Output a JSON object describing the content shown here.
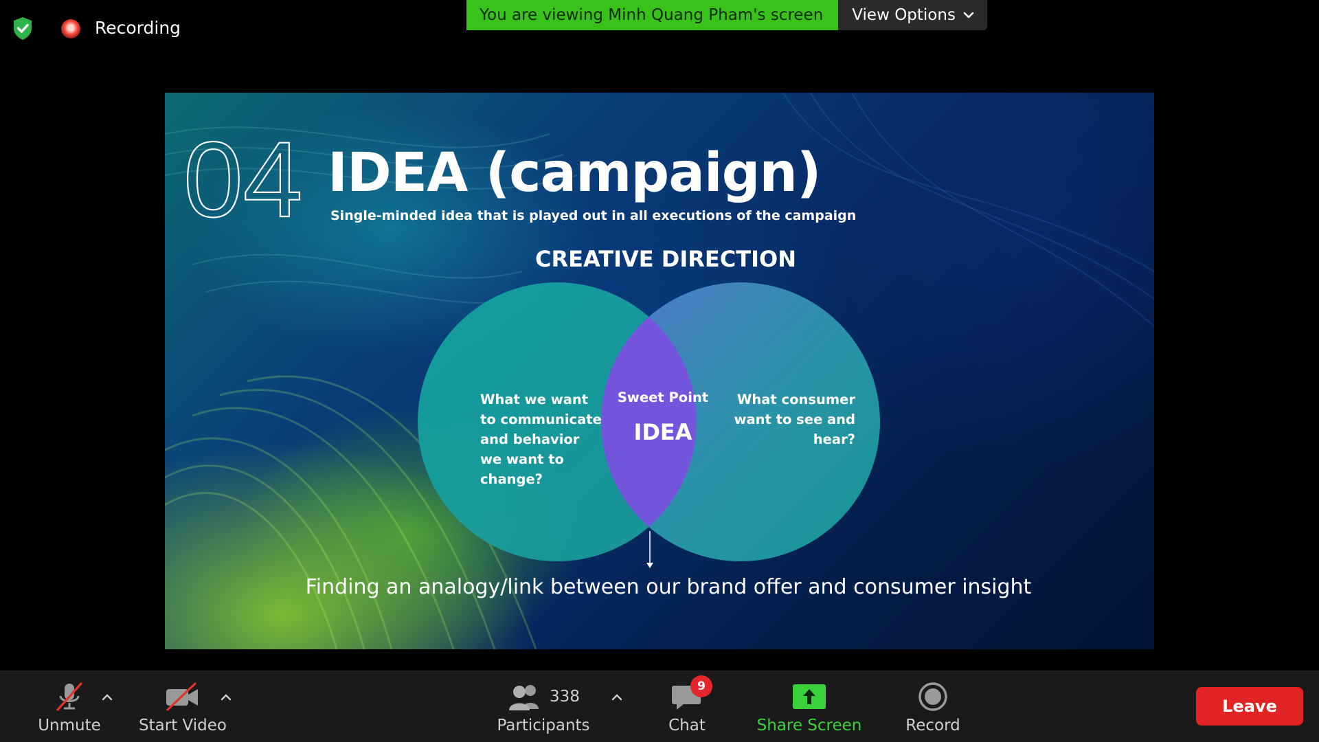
{
  "top_bar": {
    "recording_label": "Recording",
    "viewing_notice": "You are viewing Minh Quang Pham's screen",
    "view_options_label": "View Options",
    "icons": {
      "security": "shield-check-icon",
      "recording": "recording-dot-icon",
      "view_options": "chevron-down-icon"
    }
  },
  "slide": {
    "section_number": "04",
    "title": "IDEA (campaign)",
    "subtitle": "Single-minded idea that is played out in all executions of the campaign",
    "section_heading": "CREATIVE DIRECTION",
    "left_circle_lines": [
      "What we want",
      "to communicate",
      "and behavior",
      "we want to",
      "change?"
    ],
    "right_circle_lines": [
      "What consumer",
      "want to see and",
      "hear?"
    ],
    "sweet_point_label": "Sweet Point",
    "idea_label": "IDEA",
    "bottom_statement": "Finding an analogy/link between our brand offer and consumer insight"
  },
  "toolbar": {
    "unmute_label": "Unmute",
    "start_video_label": "Start Video",
    "participants_label": "Participants",
    "participants_count": "338",
    "chat_label": "Chat",
    "chat_badge": "9",
    "share_screen_label": "Share Screen",
    "record_label": "Record",
    "leave_label": "Leave",
    "icons": {
      "unmute": "muted-microphone-icon",
      "video": "video-off-icon",
      "participants": "participants-icon",
      "chat": "chat-bubble-icon",
      "share": "share-screen-icon",
      "record": "record-icon"
    }
  },
  "colors": {
    "share_green": "#3bd13b",
    "viewing_bar_green": "#39c21a",
    "leave_red": "#e02424",
    "badge_red": "#e5262d",
    "muted_red": "#e0332b"
  }
}
